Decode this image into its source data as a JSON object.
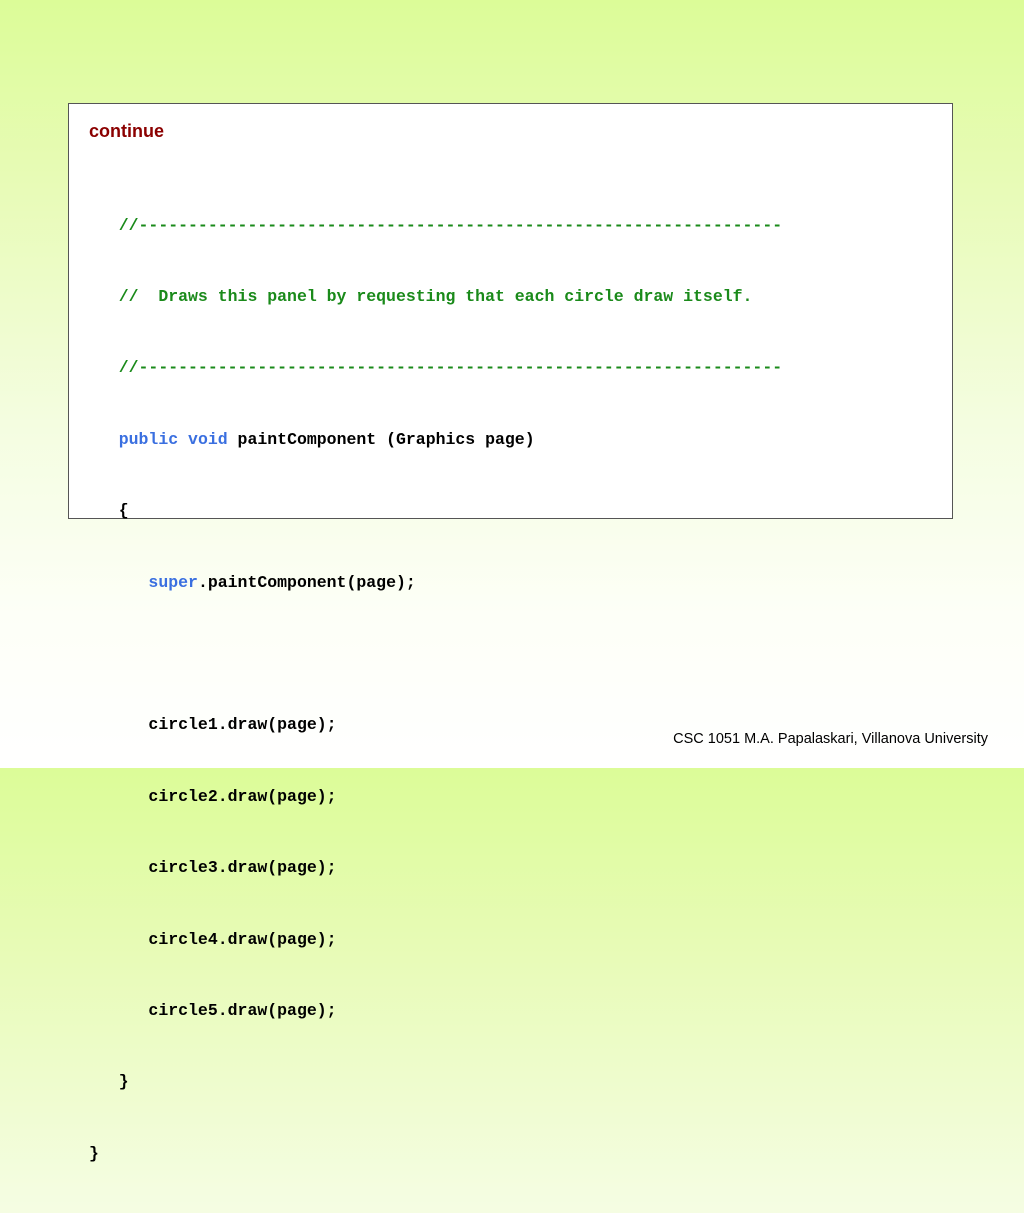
{
  "slide": {
    "heading": "continue",
    "footer": "CSC 1051 M.A. Papalaskari, Villanova University"
  },
  "code": {
    "indent1": "   ",
    "indent2": "      ",
    "comment_rule": "//-----------------------------------------------------------------",
    "comment_text": "//  Draws this panel by requesting that each circle draw itself.",
    "kw_public": "public",
    "kw_void": "void",
    "method_sig": " paintComponent (Graphics page)",
    "open_brace": "{",
    "kw_super": "super",
    "super_call": ".paintComponent(page);",
    "calls": [
      "circle1.draw(page);",
      "circle2.draw(page);",
      "circle3.draw(page);",
      "circle4.draw(page);",
      "circle5.draw(page);"
    ],
    "close_brace": "}",
    "class_close": "}"
  },
  "colors": {
    "heading": "#8b0000",
    "comment": "#1a8a1a",
    "keyword": "#3a6fe0",
    "code": "#000000"
  }
}
